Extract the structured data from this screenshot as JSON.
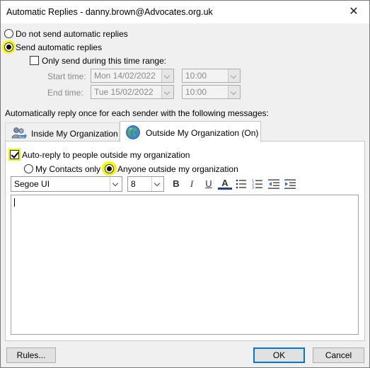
{
  "window": {
    "title": "Automatic Replies - danny.brown@Advocates.org.uk",
    "close_glyph": "✕"
  },
  "mode": {
    "no_reply_label": "Do not send automatic replies",
    "send_reply_label": "Send automatic replies",
    "selected": "send"
  },
  "time_range": {
    "checkbox_label": "Only send during this time range:",
    "checked": false,
    "start_label": "Start time:",
    "start_date": "Mon 14/02/2022",
    "start_time": "10:00",
    "end_label": "End time:",
    "end_date": "Tue 15/02/2022",
    "end_time": "10:00"
  },
  "section_label": "Automatically reply once for each sender with the following messages:",
  "tabs": [
    {
      "label": "Inside My Organization",
      "icon": "people-icon",
      "active": false
    },
    {
      "label": "Outside My Organization (On)",
      "icon": "globe-icon",
      "active": true
    }
  ],
  "outside": {
    "auto_reply_label": "Auto-reply to people outside my organization",
    "auto_reply_checked": true,
    "contacts_only_label": "My Contacts only",
    "anyone_label": "Anyone outside my organization",
    "audience_selected": "anyone"
  },
  "format": {
    "font": "Segoe UI",
    "size": "8",
    "bold": "B",
    "italic": "I",
    "underline": "U",
    "font_color": "A"
  },
  "buttons": {
    "rules": "Rules...",
    "ok": "OK",
    "cancel": "Cancel"
  },
  "colors": {
    "highlight": "#f5f500",
    "accent": "#0078d7",
    "font_color_bar": "#1f3f8f"
  }
}
